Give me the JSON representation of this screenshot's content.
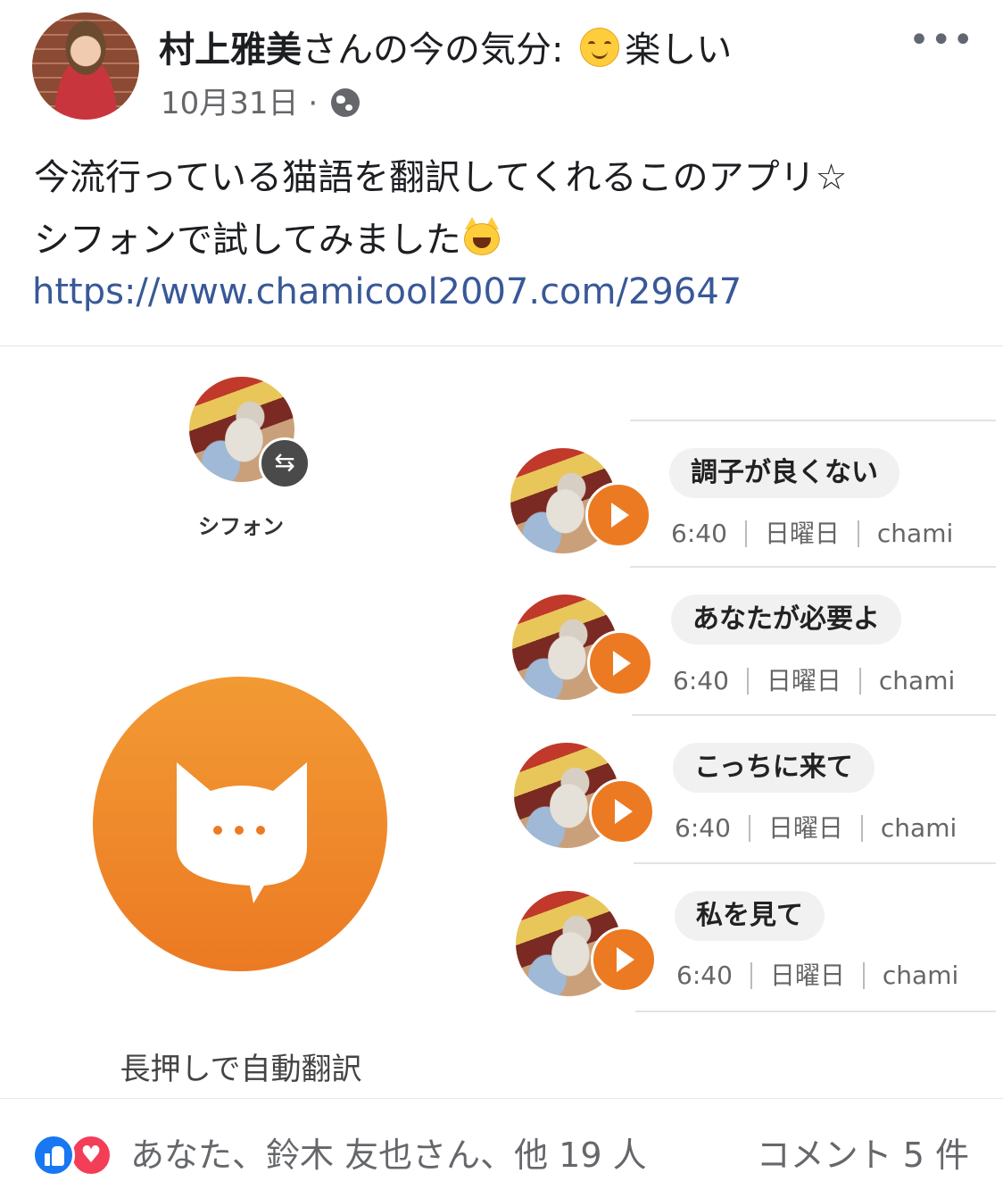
{
  "post": {
    "author": "村上雅美",
    "feeling_prefix": "さんの今の気分:",
    "feeling": "楽しい",
    "feeling_icon": "smiling-face-icon",
    "date": "10月31日",
    "separator": "·",
    "privacy_icon": "globe-icon",
    "more_label": "•••",
    "text_line1": "今流行っている猫語を翻訳してくれるこのアプリ☆",
    "text_line2": "シフォンで試してみました",
    "text_emoji": "smiling-cat-icon",
    "link": "https://www.chamicool2007.com/29647"
  },
  "shared_image": {
    "cat_name": "シフォン",
    "swap_icon": "⇆",
    "hold_hint": "長押しで自動翻訳",
    "messages": [
      {
        "text": "調子が良くない",
        "time": "6:40",
        "day": "日曜日",
        "user": "chami"
      },
      {
        "text": "あなたが必要よ",
        "time": "6:40",
        "day": "日曜日",
        "user": "chami"
      },
      {
        "text": "こっちに来て",
        "time": "6:40",
        "day": "日曜日",
        "user": "chami"
      },
      {
        "text": "私を見て",
        "time": "6:40",
        "day": "日曜日",
        "user": "chami"
      }
    ]
  },
  "footer": {
    "reactions": "あなた、鈴木 友也さん、他 19 人",
    "comments": "コメント 5 件",
    "reaction_icons": [
      "like-icon",
      "love-icon"
    ]
  },
  "colors": {
    "accent_orange": "#ec7a23",
    "link_blue": "#385898",
    "like_blue": "#1877f2",
    "love_red": "#f33e58"
  }
}
